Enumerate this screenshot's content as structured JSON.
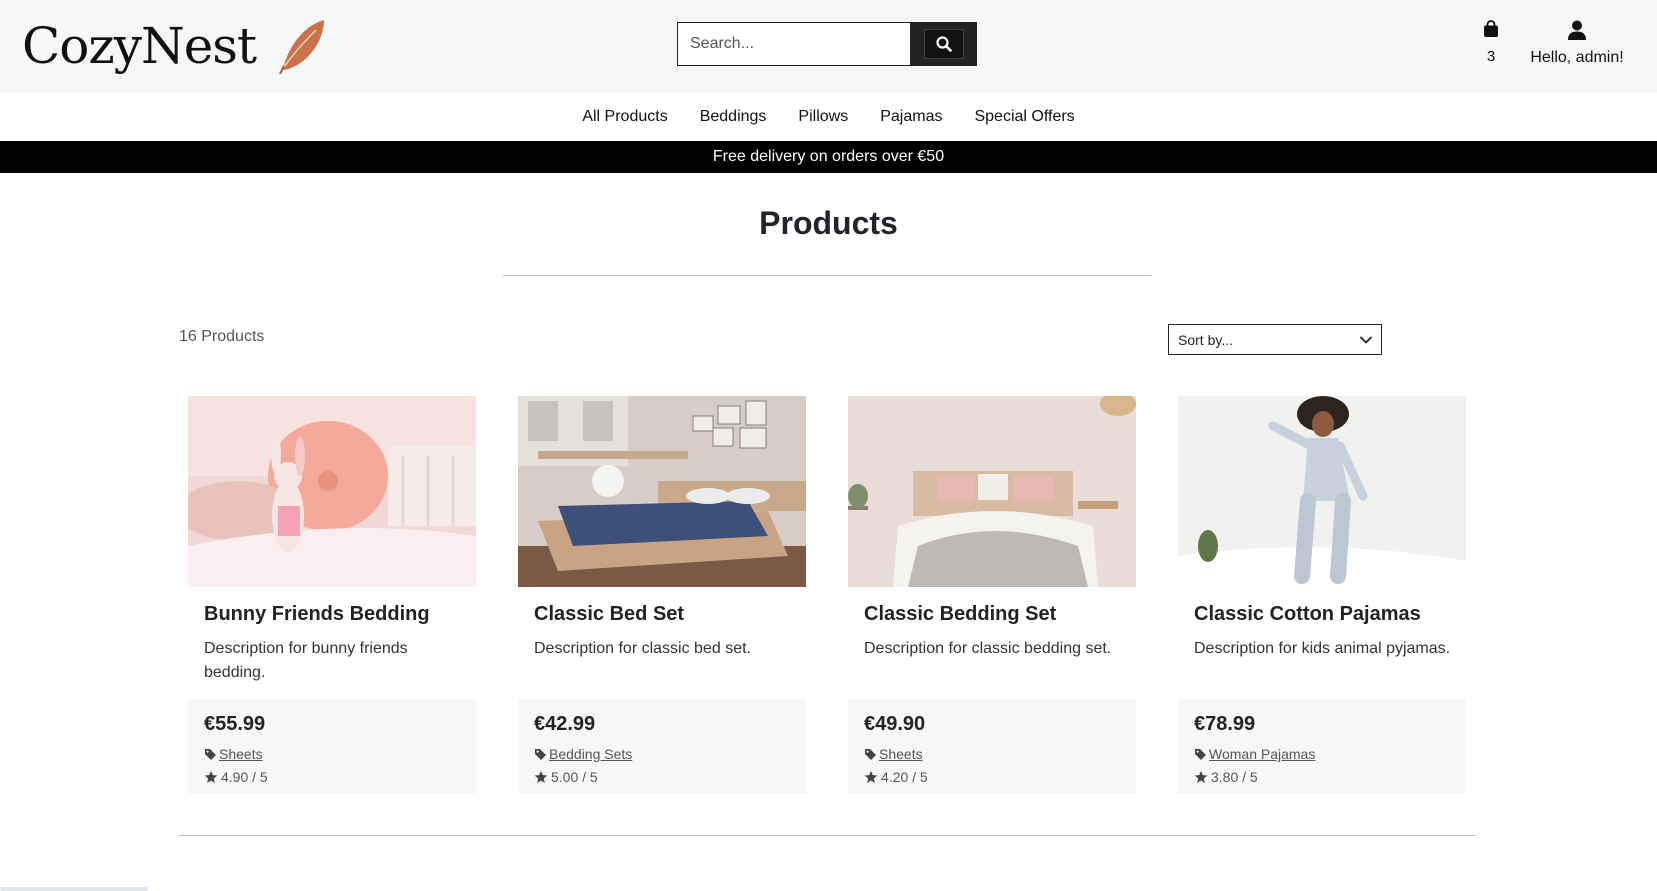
{
  "brand": {
    "name": "CozyNest",
    "logo_icon": "feather-icon",
    "accent": "#c8734a"
  },
  "search": {
    "placeholder": "Search...",
    "icon": "search-icon"
  },
  "cart": {
    "icon": "shopping-bag-icon",
    "count": "3"
  },
  "account": {
    "icon": "user-icon",
    "greeting": "Hello, admin!"
  },
  "nav": {
    "items": [
      {
        "label": "All Products"
      },
      {
        "label": "Beddings"
      },
      {
        "label": "Pillows"
      },
      {
        "label": "Pajamas"
      },
      {
        "label": "Special Offers"
      }
    ]
  },
  "banner": {
    "text": "Free delivery on orders over €50"
  },
  "page": {
    "title": "Products",
    "count_label": "16 Products"
  },
  "sort": {
    "selected": "Sort by...",
    "icon": "chevron-down-icon"
  },
  "products": [
    {
      "title": "Bunny Friends Bedding",
      "description": "Description for bunny friends bedding.",
      "price": "€55.99",
      "category": "Sheets",
      "rating": "4.90 / 5",
      "image": "pink bedding with bunny plush"
    },
    {
      "title": "Classic Bed Set",
      "description": "Description for classic bed set.",
      "price": "€42.99",
      "category": "Bedding Sets",
      "rating": "5.00 / 5",
      "image": "wooden platform bed with blue sheets"
    },
    {
      "title": "Classic Bedding Set",
      "description": "Description for classic bedding set.",
      "price": "€49.90",
      "category": "Sheets",
      "rating": "4.20 / 5",
      "image": "white bed with grey throw"
    },
    {
      "title": "Classic Cotton Pajamas",
      "description": "Description for kids animal pyjamas.",
      "price": "€78.99",
      "category": "Woman Pajamas",
      "rating": "3.80 / 5",
      "image": "woman jumping on bed in pajamas"
    }
  ]
}
